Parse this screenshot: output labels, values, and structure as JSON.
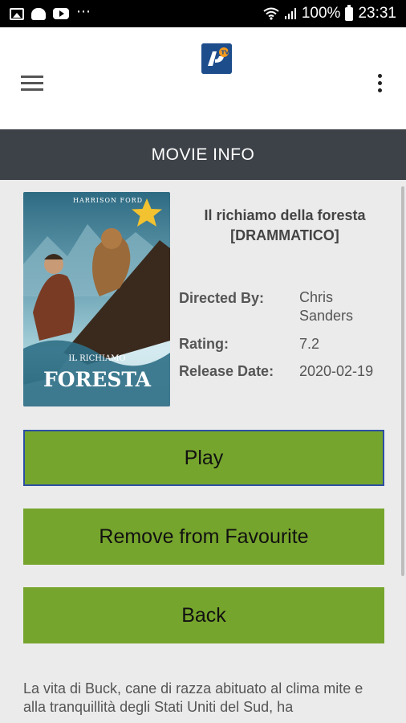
{
  "status_bar": {
    "battery": "100%",
    "time": "23:31",
    "left_icons": [
      "image-icon",
      "android-icon",
      "youtube-icon",
      "more-icon"
    ]
  },
  "header": {
    "page_title": "MOVIE INFO"
  },
  "poster_art": {
    "top_text": "HARRISON FORD",
    "title_small": "IL RICHIAMO",
    "title_large": "FORESTA"
  },
  "movie": {
    "title": "Il richiamo della foresta [DRAMMATICO]",
    "directed_by_label": "Directed By:",
    "directed_by": "Chris Sanders",
    "rating_label": "Rating:",
    "rating": "7.2",
    "release_label": "Release Date:",
    "release_date": "2020-02-19",
    "description": "La vita di Buck, cane di razza abituato al clima mite e alla tranquillità degli Stati Uniti del Sud, ha"
  },
  "actions": {
    "play": "Play",
    "remove_favourite": "Remove from Favourite",
    "back": "Back"
  },
  "colors": {
    "button": "#76a52d",
    "focus_border": "#2c4fa3",
    "title_bar": "#3d4248",
    "favourite_star": "#f2c230"
  }
}
